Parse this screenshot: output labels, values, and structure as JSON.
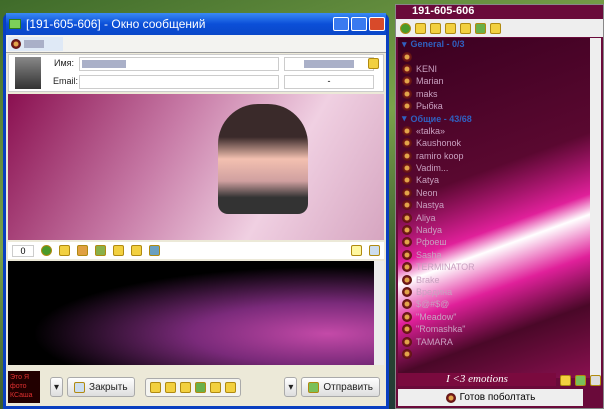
{
  "chat_window": {
    "title": "[191-605-606] - Окно сообщений",
    "name_label": "Имя:",
    "email_label": "Email:",
    "email_status": "-",
    "char_count": "0",
    "close_label": "Закрыть",
    "send_label": "Отправить",
    "avatar_text": "Это Я фото КСаша"
  },
  "contact_list": {
    "title": "191-605-606",
    "groups": [
      {
        "name": "General - 0/3",
        "contacts": [
          "",
          "KENI",
          "Marian",
          "maks",
          "Рыбка"
        ]
      },
      {
        "name": "Общие - 43/68",
        "contacts": [
          "«talka»",
          "Kaushonok",
          "ramiro koop",
          "Vadim...",
          "Katya",
          "Neon",
          "Nastya",
          "Aliya",
          "Nadya",
          "Pфоеш",
          "Sasha",
          "TERMINATOR",
          "Brake",
          "Вредина",
          "$@#$@",
          "\"Meadow\"",
          "\"Romashka\"",
          "TAMARA",
          ""
        ]
      }
    ],
    "status_text": "I <3 emotions",
    "ready_label": "Готов поболтать"
  }
}
